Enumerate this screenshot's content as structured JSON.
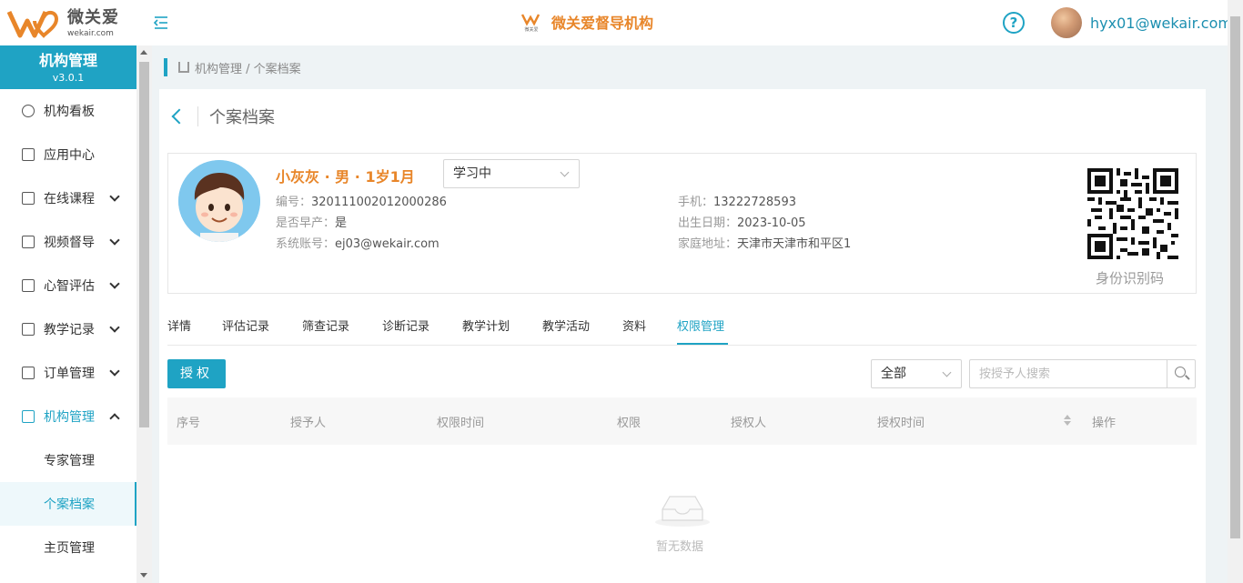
{
  "header": {
    "logo_cn": "微关爱",
    "logo_en": "wekair.com",
    "center_title": "微关爱督导机构",
    "center_logo_text": "微关爱",
    "user_email": "hyx01@wekair.com",
    "help_glyph": "?"
  },
  "sidebar": {
    "title": "机构管理",
    "version": "v3.0.1",
    "items": [
      {
        "label": "机构看板",
        "icon": "pie-chart-icon",
        "has_children": false
      },
      {
        "label": "应用中心",
        "icon": "grid-icon",
        "has_children": false
      },
      {
        "label": "在线课程",
        "icon": "book-icon",
        "has_children": true
      },
      {
        "label": "视频督导",
        "icon": "play-icon",
        "has_children": true
      },
      {
        "label": "心智评估",
        "icon": "clipboard-icon",
        "has_children": true
      },
      {
        "label": "教学记录",
        "icon": "video-camera-icon",
        "has_children": true
      },
      {
        "label": "订单管理",
        "icon": "receipt-icon",
        "has_children": true
      },
      {
        "label": "机构管理",
        "icon": "bank-icon",
        "has_children": true,
        "expanded": true
      }
    ],
    "sub_items": [
      "专家管理",
      "个案档案",
      "主页管理"
    ],
    "active_sub": "个案档案"
  },
  "breadcrumb": {
    "text": "机构管理 / 个案档案"
  },
  "page": {
    "title": "个案档案"
  },
  "profile": {
    "name_line": "小灰灰 · 男 · 1岁1月",
    "status": "学习中",
    "id_label": "编号：",
    "id_value": "320111002012000286",
    "premature_label": "是否早产：",
    "premature_value": "是",
    "account_label": "系统账号：",
    "account_value": "ej03@wekair.com",
    "phone_label": "手机：",
    "phone_value": "13222728593",
    "birth_label": "出生日期：",
    "birth_value": "2023-10-05",
    "address_label": "家庭地址：",
    "address_value": "天津市天津市和平区1",
    "qr_label": "身份识别码"
  },
  "tabs": [
    "详情",
    "评估记录",
    "筛查记录",
    "诊断记录",
    "教学计划",
    "教学活动",
    "资料",
    "权限管理"
  ],
  "active_tab": "权限管理",
  "toolbar": {
    "grant_label": "授权",
    "filter_value": "全部",
    "search_placeholder": "按授予人搜索"
  },
  "table": {
    "columns": [
      "序号",
      "授予人",
      "权限时间",
      "权限",
      "授权人",
      "授权时间",
      "操作"
    ],
    "rows": [],
    "empty_text": "暂无数据"
  },
  "colors": {
    "accent": "#1fa3c4",
    "brand_orange": "#e8862a"
  }
}
